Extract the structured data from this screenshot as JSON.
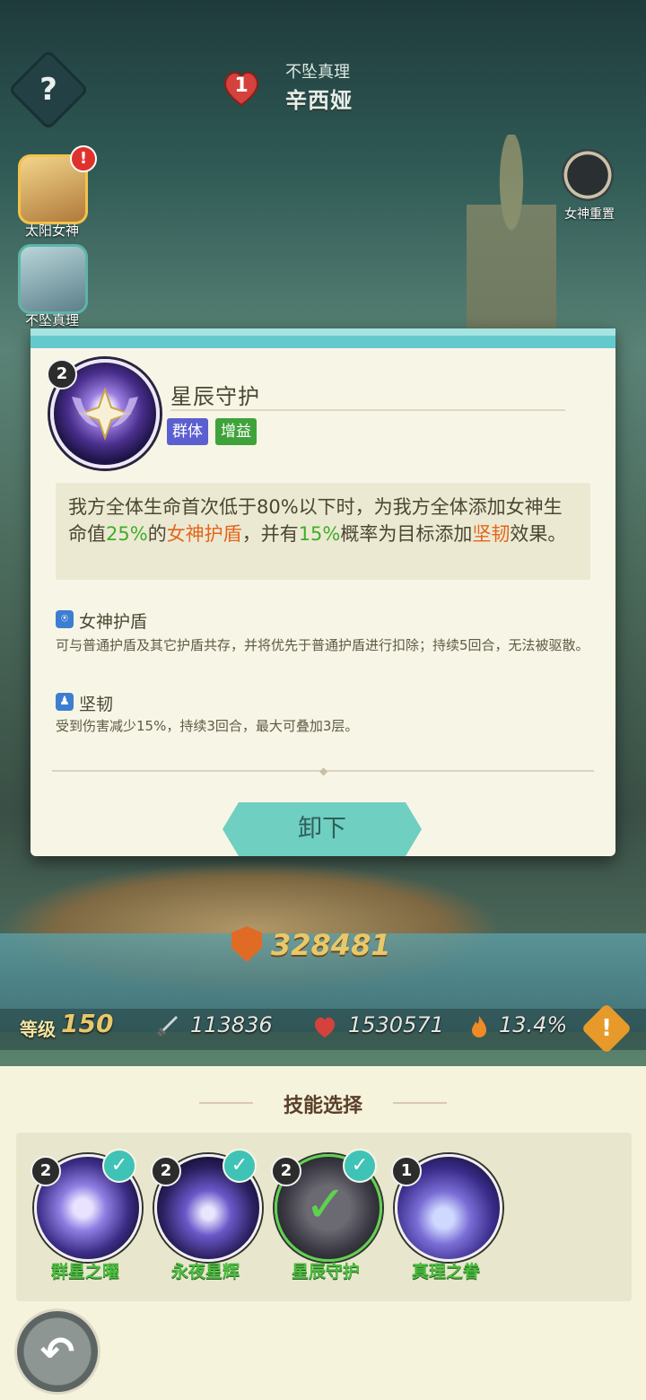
{
  "header": {
    "help_icon": "?",
    "heart_count": "1",
    "goddess_subtitle": "不坠真理",
    "goddess_name": "辛西娅"
  },
  "side": {
    "sun_goddess_label": "太阳女神",
    "sun_goddess_badge": "!",
    "truth_label": "不坠真理",
    "reset_label": "女神重置"
  },
  "popup": {
    "level": "2",
    "title": "星辰守护",
    "tags": [
      "群体",
      "增益"
    ],
    "desc": {
      "p1": "我方全体生命首次低于80%以下时，为我方全体添加女神生命值",
      "v1": "25%",
      "p2": "的",
      "k1": "女神护盾",
      "p3": "，并有",
      "v2": "15%",
      "p4": "概率为目标添加",
      "k2": "坚韧",
      "p5": "效果。"
    },
    "effects": [
      {
        "name": "女神护盾",
        "desc": "可与普通护盾及其它护盾共存，并将优先于普通护盾进行扣除；持续5回合，无法被驱散。"
      },
      {
        "name": "坚韧",
        "desc": "受到伤害减少15%，持续3回合，最大可叠加3层。"
      }
    ],
    "unload_label": "卸下"
  },
  "stats": {
    "power": "328481",
    "level_label": "等级",
    "level": "150",
    "attack": "113836",
    "hp": "1530571",
    "crit": "13.4%"
  },
  "skill_select": {
    "title": "技能选择",
    "skills": [
      {
        "name": "群星之曜",
        "level": "2",
        "equipped": true
      },
      {
        "name": "永夜星辉",
        "level": "2",
        "equipped": true
      },
      {
        "name": "星辰守护",
        "level": "2",
        "equipped": true
      },
      {
        "name": "真理之眷",
        "level": "1",
        "equipped": false
      }
    ]
  },
  "colors": {
    "accent_teal": "#64c9cc",
    "highlight_green": "#3fae2a",
    "highlight_orange": "#e3661b"
  }
}
